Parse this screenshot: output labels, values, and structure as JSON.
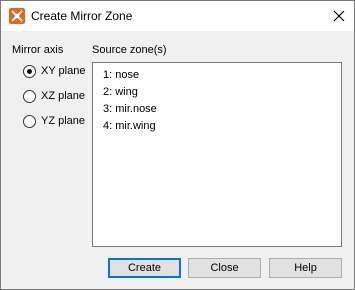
{
  "window": {
    "title": "Create Mirror Zone"
  },
  "mirror_axis": {
    "label": "Mirror axis",
    "options": [
      {
        "label": "XY plane",
        "checked": true
      },
      {
        "label": "XZ plane",
        "checked": false
      },
      {
        "label": "YZ plane",
        "checked": false
      }
    ]
  },
  "source_zones": {
    "label": "Source zone(s)",
    "items": [
      "1: nose",
      "2: wing",
      "3: mir.nose",
      "4: mir.wing"
    ]
  },
  "buttons": {
    "create": "Create",
    "close": "Close",
    "help": "Help"
  },
  "colors": {
    "accent": "#0078d7",
    "icon_orange": "#e8681a"
  }
}
